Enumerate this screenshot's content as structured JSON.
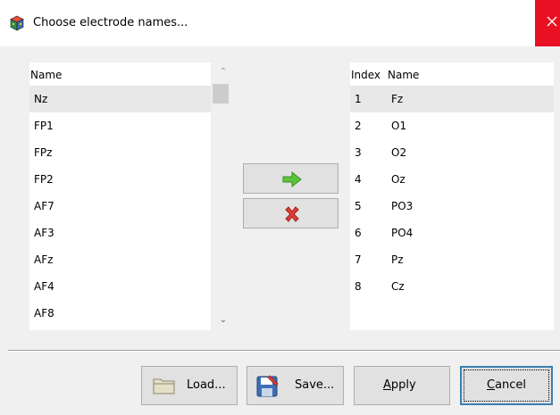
{
  "window": {
    "title": "Choose electrode names...",
    "close_icon": "close-icon"
  },
  "available": {
    "header": "Name",
    "items": [
      "Nz",
      "FP1",
      "FPz",
      "FP2",
      "AF7",
      "AF3",
      "AFz",
      "AF4",
      "AF8"
    ],
    "selected_index": 0
  },
  "chosen": {
    "header_index": "Index",
    "header_name": "Name",
    "rows": [
      {
        "index": "1",
        "name": "Fz"
      },
      {
        "index": "2",
        "name": "O1"
      },
      {
        "index": "3",
        "name": "O2"
      },
      {
        "index": "4",
        "name": "Oz"
      },
      {
        "index": "5",
        "name": "PO3"
      },
      {
        "index": "6",
        "name": "PO4"
      },
      {
        "index": "7",
        "name": "Pz"
      },
      {
        "index": "8",
        "name": "Cz"
      }
    ],
    "selected_index": 0
  },
  "middle_buttons": {
    "add_icon": "green-arrow-right-icon",
    "remove_icon": "red-x-icon"
  },
  "buttons": {
    "load": {
      "label": "Load...",
      "icon": "folder-icon"
    },
    "save": {
      "label": "Save...",
      "icon": "save-icon"
    },
    "apply": {
      "label_first": "A",
      "label_rest": "pply"
    },
    "cancel": {
      "label_first": "C",
      "label_rest": "ancel"
    }
  },
  "colors": {
    "selection": "#e8e8e8",
    "close": "#e81123",
    "accent": "#3c7fb1"
  }
}
